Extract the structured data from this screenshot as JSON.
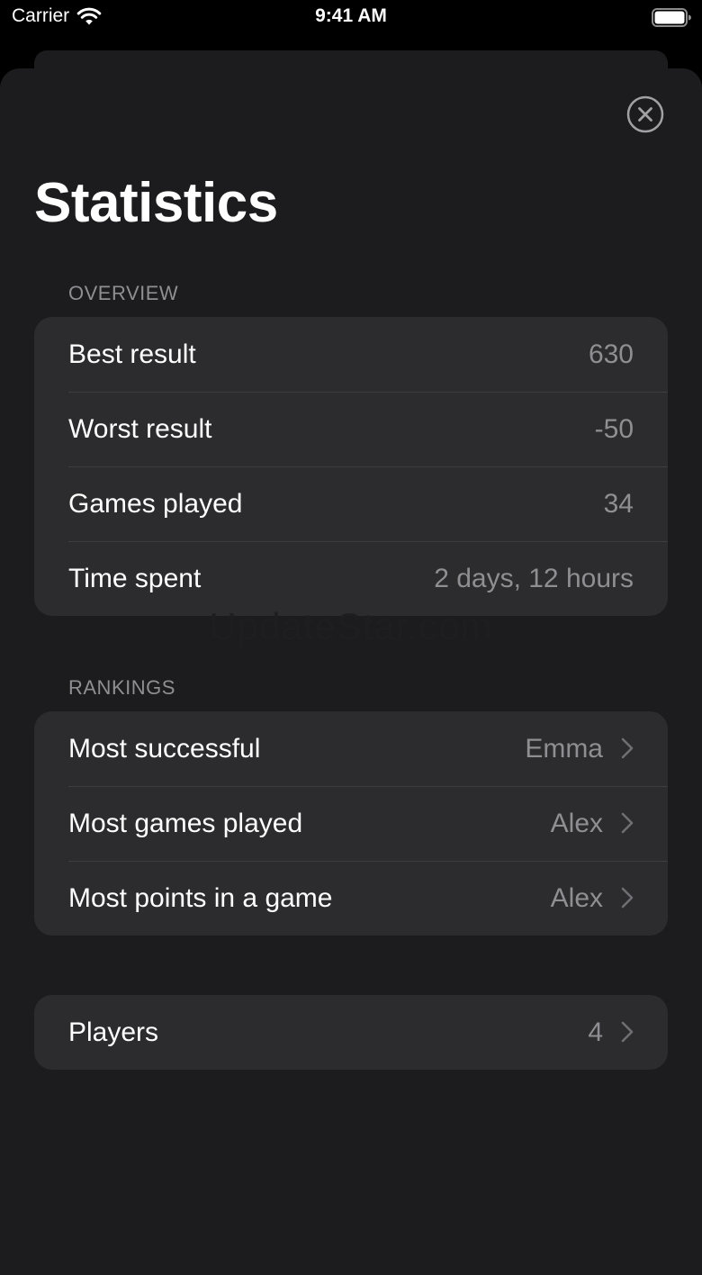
{
  "status_bar": {
    "carrier": "Carrier",
    "time": "9:41 AM",
    "icons": [
      "wifi-icon",
      "battery-icon"
    ]
  },
  "sheet": {
    "title": "Statistics",
    "close_icon": "close-circle-icon"
  },
  "overview": {
    "header": "OVERVIEW",
    "rows": [
      {
        "label": "Best result",
        "value": "630"
      },
      {
        "label": "Worst result",
        "value": "-50"
      },
      {
        "label": "Games played",
        "value": "34"
      },
      {
        "label": "Time spent",
        "value": "2 days, 12 hours"
      }
    ]
  },
  "rankings": {
    "header": "RANKINGS",
    "rows": [
      {
        "label": "Most successful",
        "value": "Emma"
      },
      {
        "label": "Most games played",
        "value": "Alex"
      },
      {
        "label": "Most points in a game",
        "value": "Alex"
      }
    ]
  },
  "players": {
    "label": "Players",
    "value": "4"
  },
  "watermark": "UpdateStar.com",
  "colors": {
    "background": "#000000",
    "sheet": "#1c1c1e",
    "group": "#2c2c2e",
    "secondary_text": "#8e8e93",
    "primary_text": "#ffffff"
  }
}
